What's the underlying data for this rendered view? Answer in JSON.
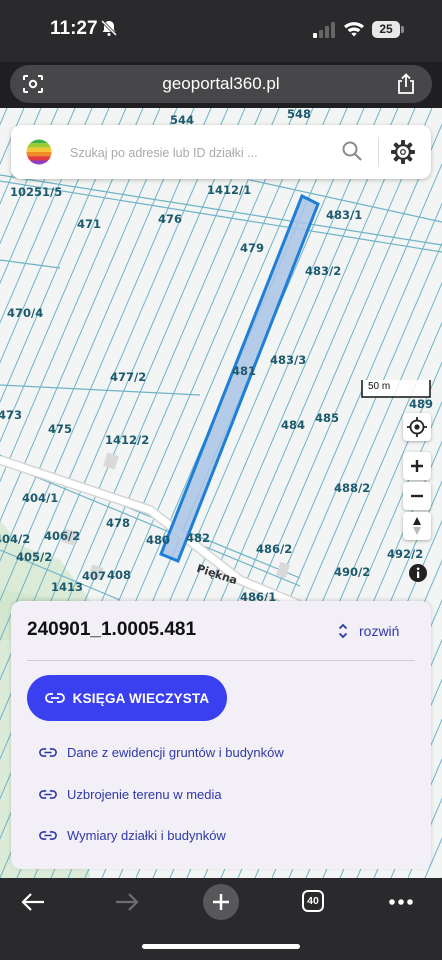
{
  "status_bar": {
    "time": "11:27",
    "battery": "25"
  },
  "browser": {
    "url": "geoportal360.pl",
    "tab_count": "40"
  },
  "search": {
    "placeholder": "Szukaj po adresie lub ID działki ..."
  },
  "map": {
    "scale_label": "50 m",
    "street_name": "Piękna",
    "parcel_labels": [
      "544",
      "548",
      "10251/5",
      "1412/1",
      "483/1",
      "471",
      "476",
      "479",
      "483/2",
      "470/4",
      "481",
      "483/3",
      "477/2",
      "473",
      "475",
      "484",
      "485",
      "489",
      "1412/2",
      "488/2",
      "404/1",
      "478",
      "480",
      "482",
      "486/2",
      "492/2",
      "404/2",
      "406/2",
      "405/2",
      "490/2",
      "1413",
      "407",
      "408",
      "486/1"
    ]
  },
  "panel": {
    "parcel_id": "240901_1.0005.481",
    "expand_label": "rozwiń",
    "kw_button_label": "KSIĘGA WIECZYSTA",
    "links": [
      "Dane z ewidencji gruntów i budynków",
      "Uzbrojenie terenu w media",
      "Wymiary działki i budynków"
    ]
  },
  "colors": {
    "accent": "#3a3ff0",
    "link": "#2e3aa8",
    "parcel_fill": "#a9c4e6",
    "parcel_stroke": "#1f7fd6",
    "boundary": "#6fb3c6"
  }
}
